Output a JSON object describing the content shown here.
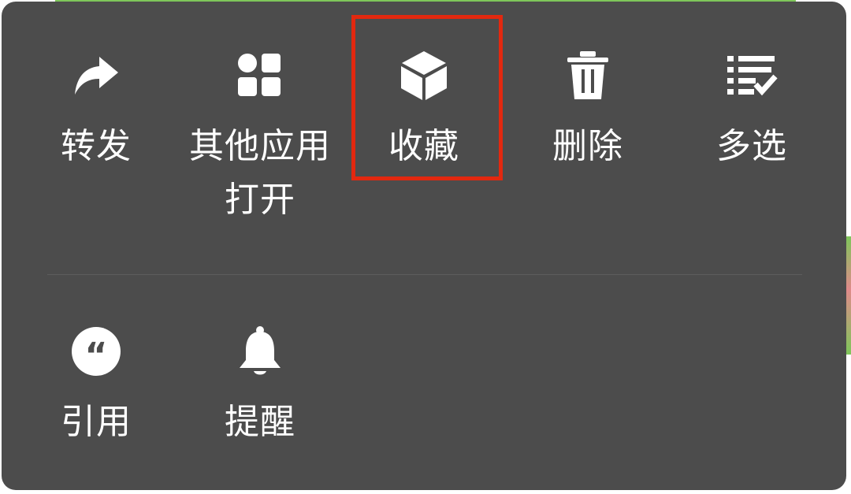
{
  "menu": {
    "row1": [
      {
        "name": "forward",
        "icon": "share-arrow-icon",
        "label": "转发"
      },
      {
        "name": "open-with-other-app",
        "icon": "apps-grid-icon",
        "label": "其他应用打开"
      },
      {
        "name": "favorite",
        "icon": "cube-icon",
        "label": "收藏"
      },
      {
        "name": "delete",
        "icon": "trash-icon",
        "label": "删除"
      },
      {
        "name": "multi-select",
        "icon": "checklist-icon",
        "label": "多选"
      }
    ],
    "row2": [
      {
        "name": "quote",
        "icon": "quote-icon",
        "label": "引用"
      },
      {
        "name": "remind",
        "icon": "bell-icon",
        "label": "提醒"
      }
    ],
    "highlighted_item": "收藏"
  },
  "colors": {
    "menu_background": "#4c4c4c",
    "text": "#ffffff",
    "icon": "#ffffff",
    "highlight_border": "#e2280f",
    "divider": "#5c5c5c"
  }
}
